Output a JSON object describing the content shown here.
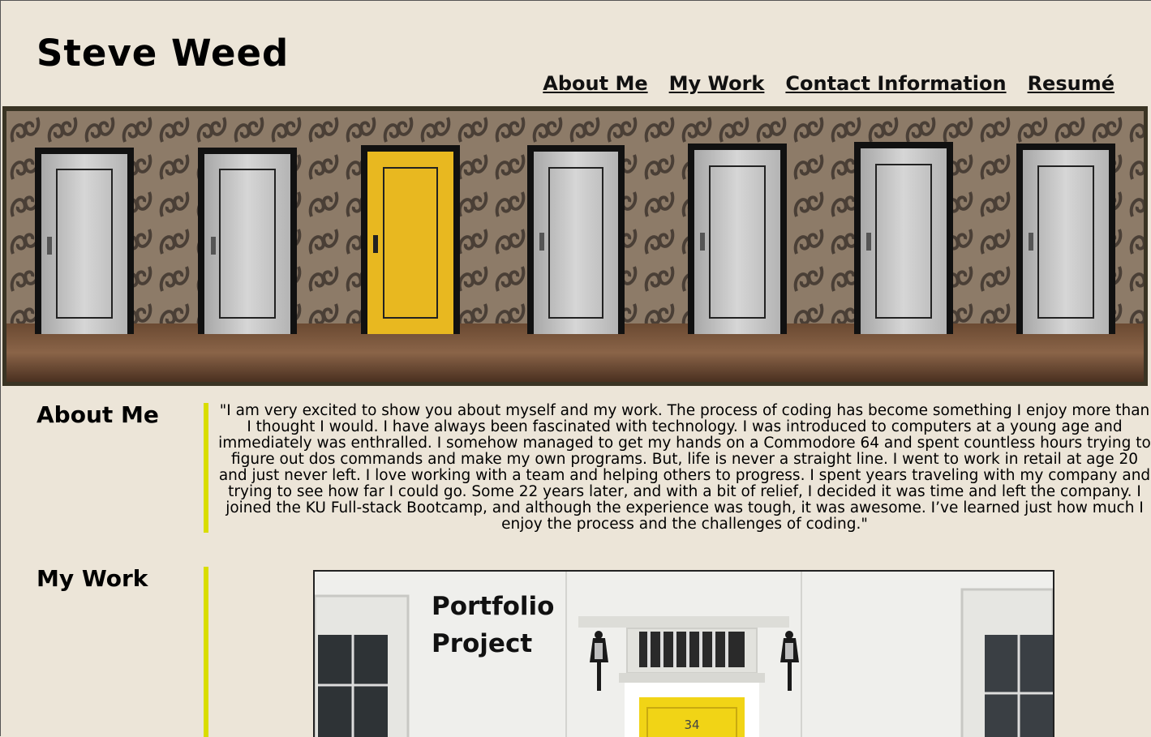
{
  "header": {
    "title": "Steve Weed"
  },
  "nav": {
    "items": [
      "About Me",
      "My Work",
      "Contact Information",
      "Resumé"
    ]
  },
  "about": {
    "heading": "About Me",
    "text": "\"I am very excited to show you about myself and my work. The process of coding has become something I enjoy more than I thought I would. I have always been fascinated with technology. I was introduced to computers at a young age and immediately was enthralled. I somehow managed to get my hands on a Commodore 64 and spent countless hours trying to figure out dos commands and make my own programs. But, life is never a straight line. I went to work in retail at age 20 and just never left. I love working with a team and helping others to progress. I spent years traveling with my company and trying to see how far I could go. Some 22 years later, and with a bit of relief, I decided it was time and left the company. I joined the KU Full-stack Bootcamp, and although the experience was tough, it was awesome. I’ve learned just how much I enjoy the process and the challenges of coding.\""
  },
  "work": {
    "heading": "My Work",
    "project_label": "Portfolio Project",
    "door_number": "34"
  },
  "colors": {
    "background": "#ece5d8",
    "accent_rule": "#d9dd00",
    "door_yellow": "#e8b820"
  }
}
